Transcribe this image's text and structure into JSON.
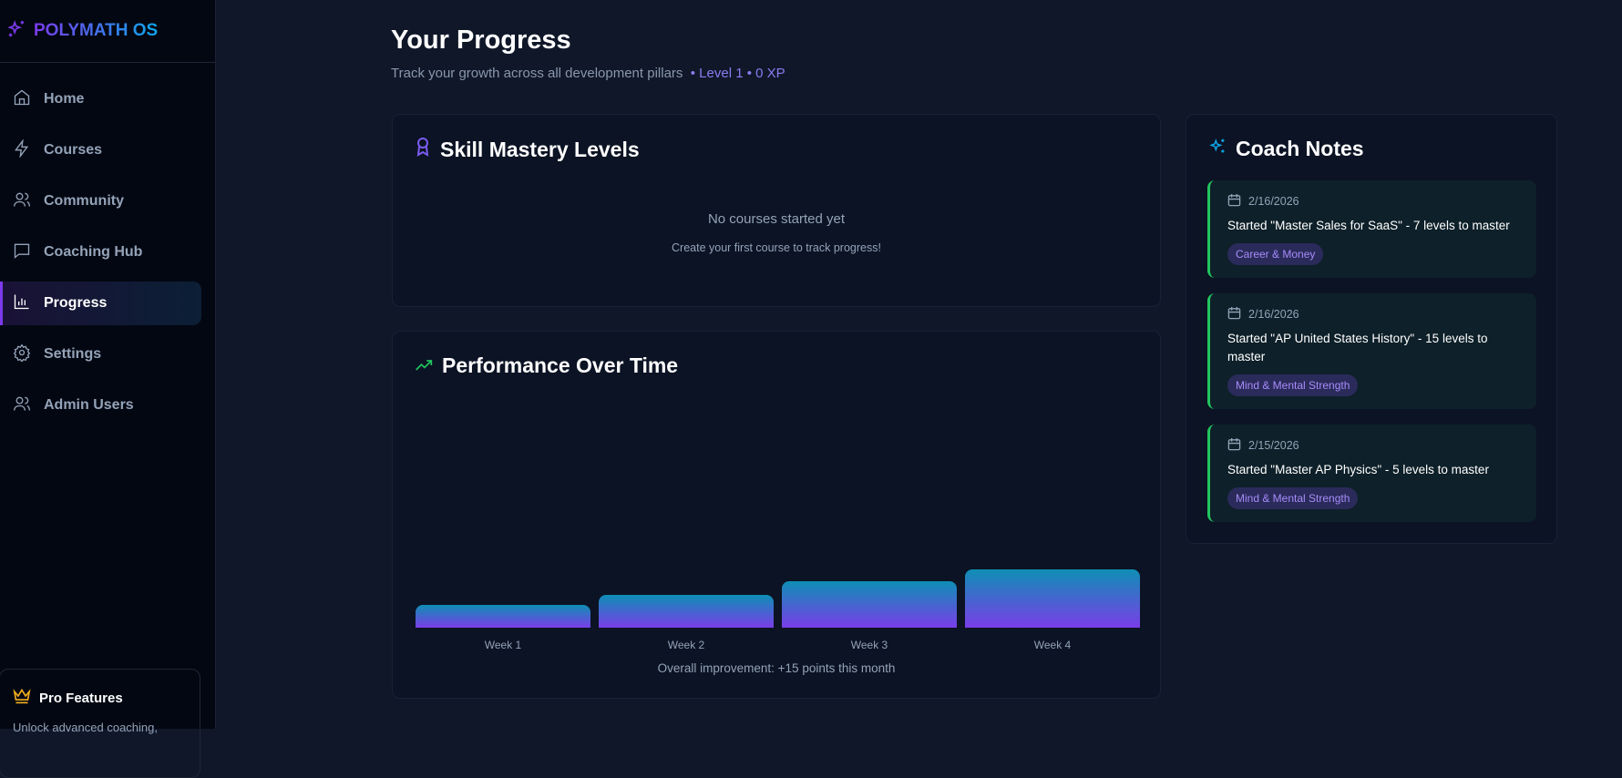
{
  "brand": {
    "name": "POLYMATH OS"
  },
  "sidebar": {
    "items": [
      {
        "label": "Home",
        "icon": "home-icon"
      },
      {
        "label": "Courses",
        "icon": "bolt-icon"
      },
      {
        "label": "Community",
        "icon": "users-icon"
      },
      {
        "label": "Coaching Hub",
        "icon": "message-icon"
      },
      {
        "label": "Progress",
        "icon": "bar-chart-icon",
        "active": true
      },
      {
        "label": "Settings",
        "icon": "gear-icon"
      },
      {
        "label": "Admin Users",
        "icon": "users-icon"
      }
    ],
    "pro": {
      "title": "Pro Features",
      "text": "Unlock advanced coaching,"
    }
  },
  "header": {
    "title": "Your Progress",
    "subtitle": "Track your growth across all development pillars",
    "level": "• Level 1 • 0 XP"
  },
  "skill": {
    "title": "Skill Mastery Levels",
    "empty_title": "No courses started yet",
    "empty_text": "Create your first course to track progress!"
  },
  "performance": {
    "title": "Performance Over Time",
    "summary": "Overall improvement: +15 points this month"
  },
  "chart_data": {
    "type": "bar",
    "categories": [
      "Week 1",
      "Week 2",
      "Week 3",
      "Week 4"
    ],
    "values": [
      39,
      57,
      79,
      100
    ],
    "ylim": [
      0,
      100
    ],
    "title": "Performance Over Time",
    "xlabel": "",
    "ylabel": ""
  },
  "coach": {
    "title": "Coach Notes",
    "notes": [
      {
        "date": "2/16/2026",
        "text": "Started \"Master Sales for SaaS\" - 7 levels to master",
        "tag": "Career & Money"
      },
      {
        "date": "2/16/2026",
        "text": "Started \"AP United States History\" - 15 levels to master",
        "tag": "Mind & Mental Strength"
      },
      {
        "date": "2/15/2026",
        "text": "Started \"Master AP Physics\" - 5 levels to master",
        "tag": "Mind & Mental Strength"
      }
    ]
  },
  "colors": {
    "accent": "#7c3aed",
    "accent2": "#0ea5e9",
    "note_border": "#22c55e",
    "tag_text": "#a78bfa"
  }
}
